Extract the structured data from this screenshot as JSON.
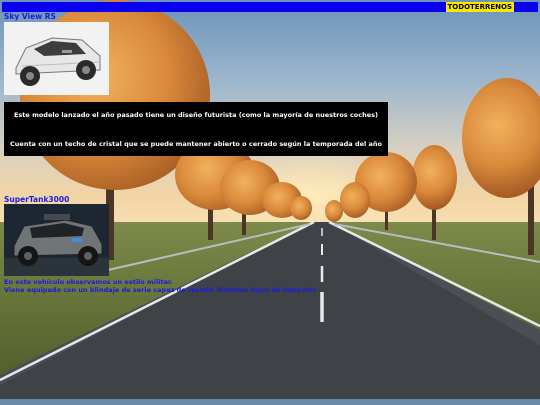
{
  "header": {
    "brand": "TODOTERRENOS"
  },
  "cards": [
    {
      "title": "Sky View RS",
      "image_icon": "white-suv-car-icon"
    },
    {
      "title": "SuperTank3000",
      "image_icon": "military-armored-vehicle-icon"
    }
  ],
  "description_box": {
    "line1": "Este modelo lanzado el año pasado tiene un diseño futurista (como la mayoría de nuestros coches)",
    "line2": "Cuenta con un techo de cristal que se puede mantener abierto o cerrado según la temporada del año"
  },
  "military_text": {
    "line1": "En este vehículo observamos un estilo militar.",
    "line2": "Viene equipado con un blindaje de serie capaz de resistir distintos tipos de impactos"
  },
  "colors": {
    "bar": "#0a00f0",
    "brand_bg": "#ffe600",
    "link_text": "#1a1ae0"
  }
}
